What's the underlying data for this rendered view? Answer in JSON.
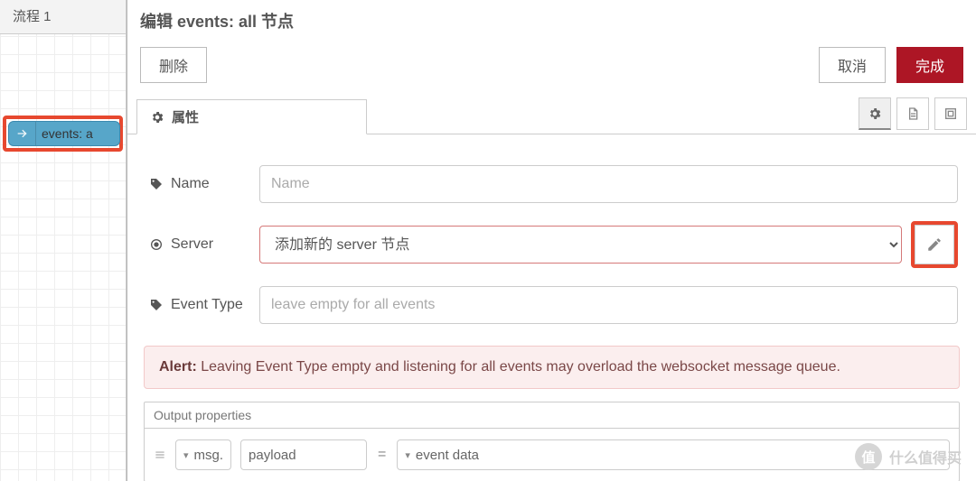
{
  "canvas": {
    "flow_tab": "流程 1",
    "node_label": "events: a"
  },
  "header": {
    "title": "编辑 events: all 节点",
    "delete": "删除",
    "cancel": "取消",
    "done": "完成"
  },
  "tabs": {
    "attributes": "属性"
  },
  "form": {
    "name_label": "Name",
    "name_placeholder": "Name",
    "server_label": "Server",
    "server_option": "添加新的 server 节点",
    "event_type_label": "Event Type",
    "event_type_placeholder": "leave empty for all events"
  },
  "alert": {
    "prefix": "Alert:",
    "body": " Leaving Event Type empty and listening for all events may overload the websocket message queue."
  },
  "output": {
    "heading": "Output properties",
    "msg_type": "msg.",
    "msg_key": "payload",
    "equals": "=",
    "value_type": "event data"
  },
  "watermark": {
    "badge": "值",
    "text": "什么值得买"
  }
}
